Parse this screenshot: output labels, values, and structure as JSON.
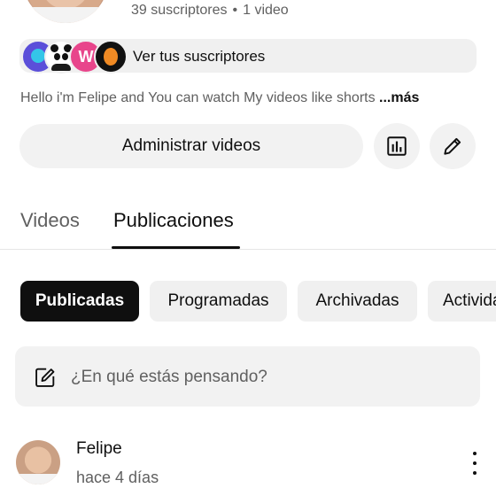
{
  "channel": {
    "subscribers_text": "39 suscriptores",
    "separator": "•",
    "videos_text": "1 video",
    "subscribers_button_label": "Ver tus suscriptores",
    "subscriber_avatar_letter": "W",
    "description": "Hello i'm Felipe and You can watch My videos like shorts ",
    "description_more": "...más"
  },
  "actions": {
    "manage_videos_label": "Administrar videos",
    "analytics_icon": "bar-chart-icon",
    "edit_icon": "pencil-icon"
  },
  "tabs": [
    {
      "label": "Videos",
      "selected": false
    },
    {
      "label": "Publicaciones",
      "selected": true
    }
  ],
  "chips": [
    {
      "label": "Publicadas",
      "selected": true
    },
    {
      "label": "Programadas",
      "selected": false
    },
    {
      "label": "Archivadas",
      "selected": false
    },
    {
      "label": "Actividad",
      "selected": false
    }
  ],
  "composer": {
    "placeholder": "¿En qué estás pensando?",
    "icon": "edit-post-icon"
  },
  "post": {
    "author": "Felipe",
    "time": "hace 4 días"
  },
  "colors": {
    "text_primary": "#0f0f0f",
    "text_secondary": "#606060",
    "chip_bg": "#f0f0f0",
    "chip_selected_bg": "#0f0f0f"
  }
}
